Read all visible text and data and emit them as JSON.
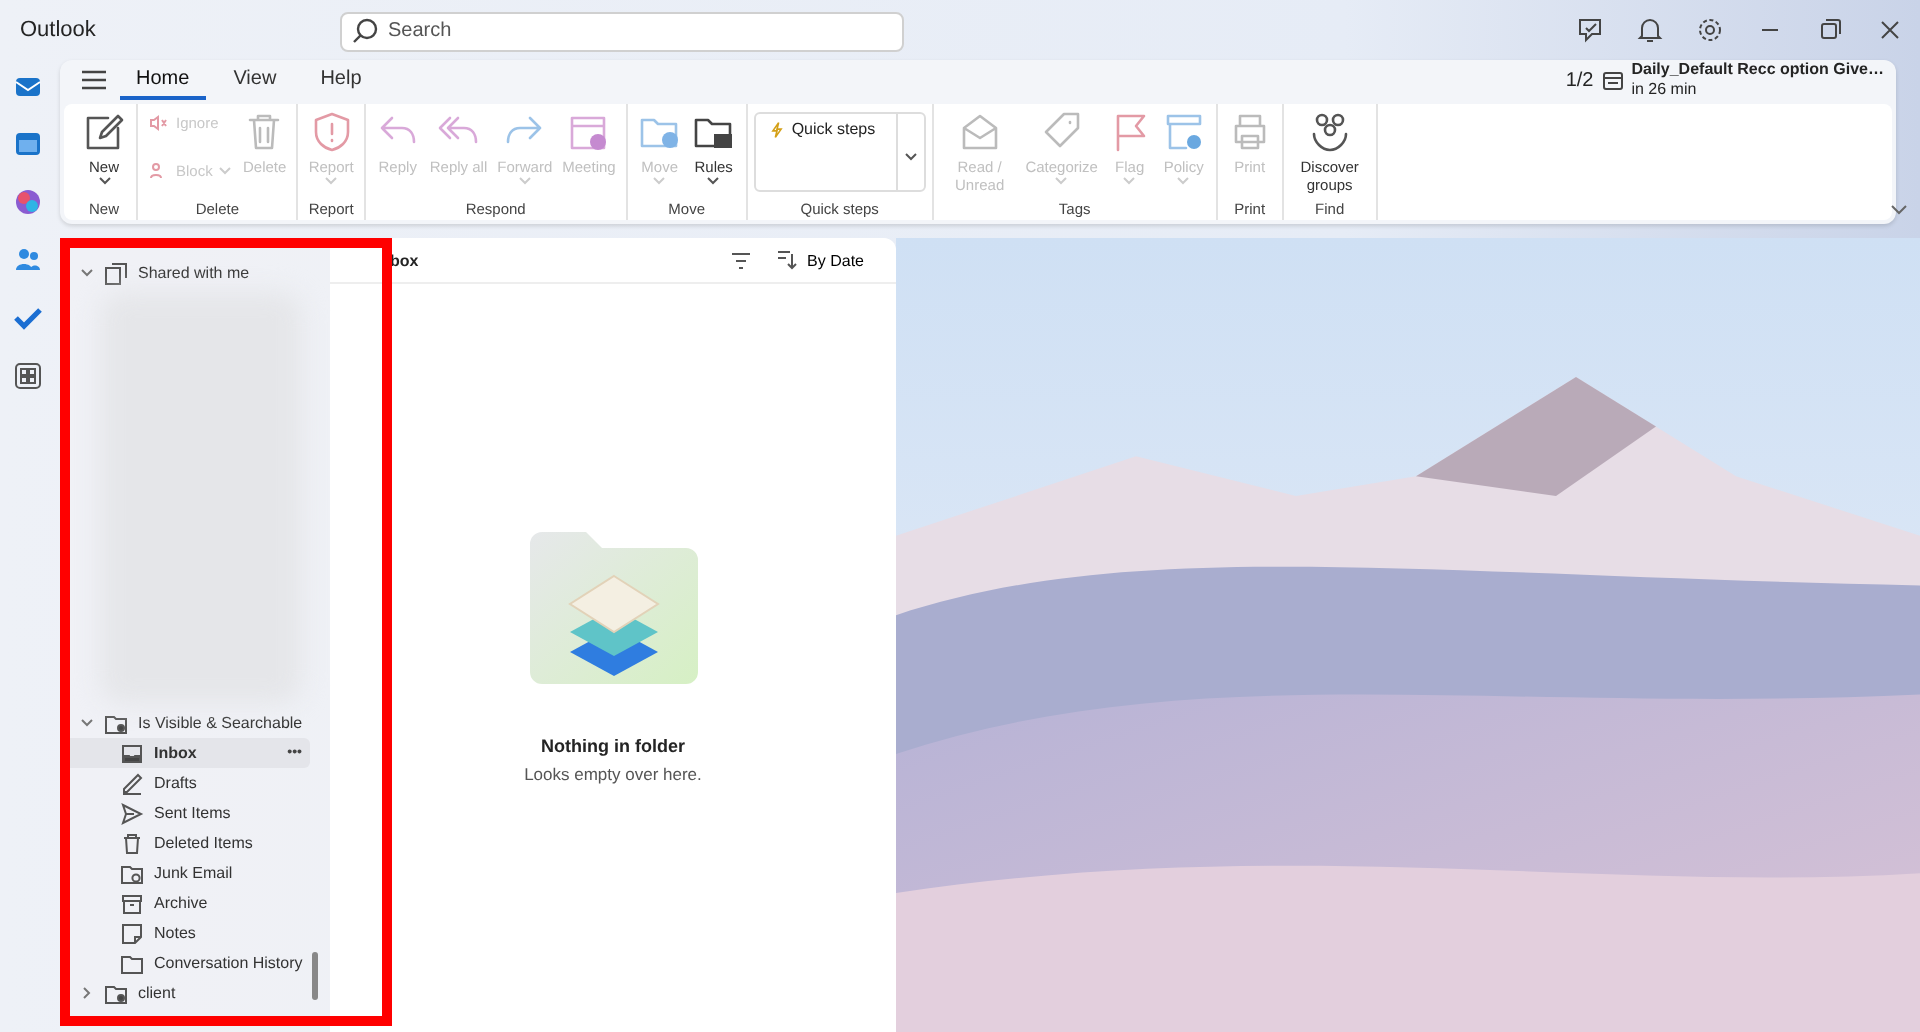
{
  "app": {
    "title": "Outlook"
  },
  "search": {
    "placeholder": "Search"
  },
  "tabs": [
    {
      "label": "Home",
      "selected": true
    },
    {
      "label": "View",
      "selected": false
    },
    {
      "label": "Help",
      "selected": false
    }
  ],
  "reminder": {
    "counter": "1/2",
    "title": "Daily_Default Recc option Give…",
    "time": "in 26 min"
  },
  "ribbon": {
    "groups": [
      {
        "label": "New",
        "buttons": [
          {
            "kind": "large",
            "label": "New",
            "disabled": false,
            "dropdown": true
          }
        ]
      },
      {
        "label": "Delete",
        "buttons": [
          {
            "kind": "small",
            "label": "Ignore",
            "disabled": true,
            "dropdown": false
          },
          {
            "kind": "small",
            "label": "Block",
            "disabled": true,
            "dropdown": true
          },
          {
            "kind": "large",
            "label": "Delete",
            "disabled": true,
            "dropdown": false
          }
        ]
      },
      {
        "label": "Report",
        "buttons": [
          {
            "kind": "large",
            "label": "Report",
            "disabled": true,
            "dropdown": true
          }
        ]
      },
      {
        "label": "Respond",
        "buttons": [
          {
            "kind": "large",
            "label": "Reply",
            "disabled": true,
            "dropdown": false
          },
          {
            "kind": "large",
            "label": "Reply all",
            "disabled": true,
            "dropdown": false
          },
          {
            "kind": "large",
            "label": "Forward",
            "disabled": true,
            "dropdown": true
          },
          {
            "kind": "large",
            "label": "Meeting",
            "disabled": true,
            "dropdown": false
          }
        ]
      },
      {
        "label": "Move",
        "buttons": [
          {
            "kind": "large",
            "label": "Move",
            "disabled": true,
            "dropdown": true
          },
          {
            "kind": "large",
            "label": "Rules",
            "disabled": false,
            "dropdown": true
          }
        ]
      },
      {
        "label": "Quick steps",
        "buttons": [
          {
            "kind": "quick",
            "label": "Quick steps",
            "disabled": false,
            "dropdown": true
          }
        ]
      },
      {
        "label": "Tags",
        "buttons": [
          {
            "kind": "large",
            "label": "Read / Unread",
            "disabled": true,
            "dropdown": false
          },
          {
            "kind": "large",
            "label": "Categorize",
            "disabled": true,
            "dropdown": true
          },
          {
            "kind": "large",
            "label": "Flag",
            "disabled": true,
            "dropdown": true
          },
          {
            "kind": "large",
            "label": "Policy",
            "disabled": true,
            "dropdown": true
          }
        ]
      },
      {
        "label": "Print",
        "buttons": [
          {
            "kind": "large",
            "label": "Print",
            "disabled": true,
            "dropdown": false
          }
        ]
      },
      {
        "label": "Find",
        "buttons": [
          {
            "kind": "large",
            "label": "Discover groups",
            "disabled": false,
            "dropdown": false
          }
        ]
      }
    ]
  },
  "folder_pane": {
    "more_label": "•••",
    "folders": [
      {
        "name": "Shared with me",
        "expanded": true,
        "selected": false,
        "blurred_children": true
      },
      {
        "name": "Is Visible & Searchable",
        "expanded": true,
        "selected": false,
        "children": [
          {
            "name": "Inbox",
            "selected": true
          },
          {
            "name": "Drafts",
            "selected": false
          },
          {
            "name": "Sent Items",
            "selected": false
          },
          {
            "name": "Deleted Items",
            "selected": false
          },
          {
            "name": "Junk Email",
            "selected": false
          },
          {
            "name": "Archive",
            "selected": false
          },
          {
            "name": "Notes",
            "selected": false
          },
          {
            "name": "Conversation History",
            "selected": false
          }
        ]
      },
      {
        "name": "client",
        "expanded": false,
        "selected": false
      }
    ]
  },
  "message_list": {
    "title": "box",
    "sort_label": "By Date",
    "empty_title": "Nothing in folder",
    "empty_subtitle": "Looks empty over here."
  }
}
